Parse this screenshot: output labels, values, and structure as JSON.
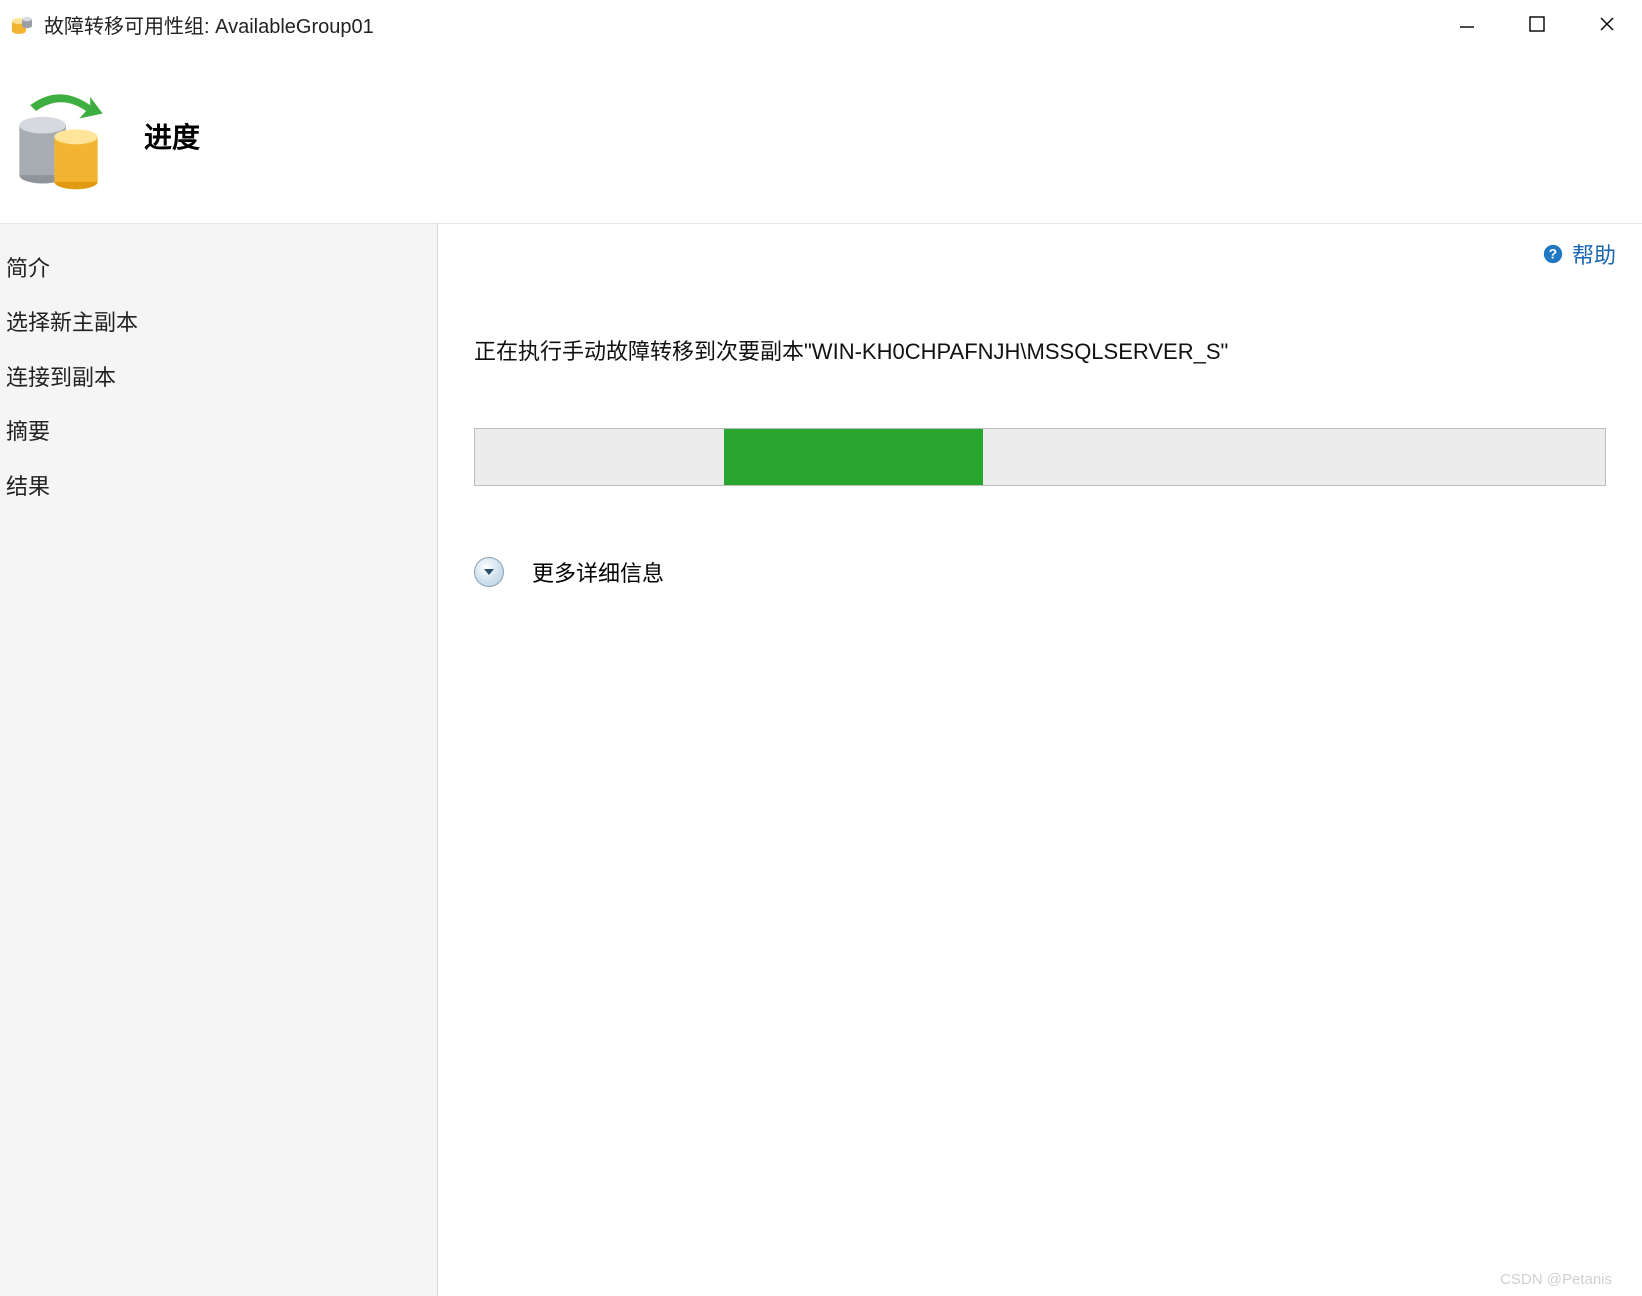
{
  "window": {
    "title": "故障转移可用性组: AvailableGroup01"
  },
  "header": {
    "page_title": "进度"
  },
  "sidebar": {
    "items": [
      {
        "label": "简介"
      },
      {
        "label": "选择新主副本"
      },
      {
        "label": "连接到副本"
      },
      {
        "label": "摘要"
      },
      {
        "label": "结果"
      }
    ]
  },
  "main": {
    "help_label": "帮助",
    "status_text": "正在执行手动故障转移到次要副本\"WIN-KH0CHPAFNJH\\MSSQLSERVER_S\"",
    "progress": {
      "offset_pct": 22,
      "width_pct": 23
    },
    "more_details_label": "更多详细信息"
  },
  "watermark": "CSDN @Petanis"
}
